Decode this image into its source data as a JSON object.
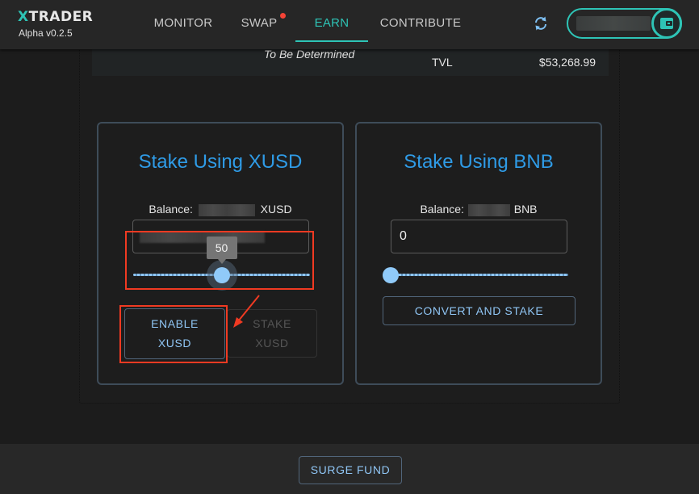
{
  "header": {
    "logo_prefix": "X",
    "logo_rest": "TRADER",
    "version": "Alpha v0.2.5",
    "nav": [
      {
        "label": "MONITOR",
        "active": false
      },
      {
        "label": "SWAP",
        "active": false,
        "notification": true
      },
      {
        "label": "EARN",
        "active": true
      },
      {
        "label": "CONTRIBUTE",
        "active": false
      }
    ],
    "refresh_icon": "refresh-icon",
    "wallet_icon": "wallet-icon",
    "accent": "#2ec4b6"
  },
  "info": {
    "status": "To Be Determined",
    "tvl_label": "TVL",
    "tvl_value": "$53,268.99"
  },
  "cards": [
    {
      "title": "Stake Using XUSD",
      "balance_label": "Balance:",
      "balance_unit": "XUSD",
      "slider_value": 50,
      "slider_percent": 50,
      "buttons": [
        {
          "line1": "ENABLE",
          "line2": "XUSD",
          "enabled": true
        },
        {
          "line1": "STAKE",
          "line2": "XUSD",
          "enabled": false
        }
      ]
    },
    {
      "title": "Stake Using BNB",
      "balance_label": "Balance:",
      "balance_unit": "BNB",
      "input_value": "0",
      "slider_percent": 0,
      "button": "CONVERT AND STAKE"
    }
  ],
  "footer": {
    "button": "SURGE FUND"
  },
  "colors": {
    "title_blue": "#2f9be6",
    "button_text": "#90c6f5",
    "annotation_red": "#f03a22"
  }
}
